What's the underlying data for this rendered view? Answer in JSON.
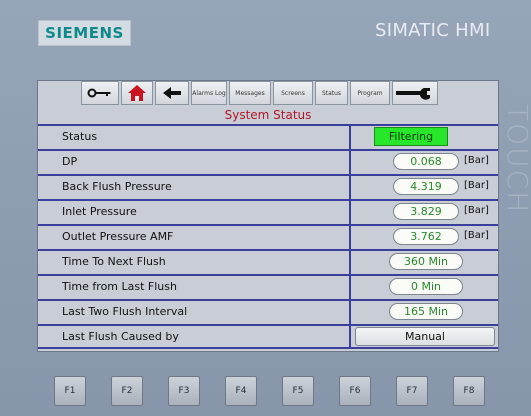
{
  "header": {
    "logo_text": "SIEMENS",
    "brand": "SIMATIC HMI",
    "side_text": "TOUCH"
  },
  "toolbar": {
    "buttons": [
      {
        "icon": "key-icon",
        "label": ""
      },
      {
        "icon": "home-icon",
        "label": ""
      },
      {
        "icon": "back-arrow-icon",
        "label": ""
      },
      {
        "icon": "",
        "label": "Alarms Log"
      },
      {
        "icon": "",
        "label": "Messages"
      },
      {
        "icon": "",
        "label": "Screens"
      },
      {
        "icon": "",
        "label": "Status"
      },
      {
        "icon": "",
        "label": "Program"
      },
      {
        "icon": "wrench-icon",
        "label": ""
      }
    ]
  },
  "screen": {
    "title": "System Status"
  },
  "rows": [
    {
      "label": "Status",
      "value": "Filtering",
      "unit": "",
      "kind": "status"
    },
    {
      "label": "DP",
      "value": "0.068",
      "unit": "[Bar]",
      "kind": "numeric"
    },
    {
      "label": "Back Flush Pressure",
      "value": "4.319",
      "unit": "[Bar]",
      "kind": "numeric"
    },
    {
      "label": "Inlet Pressure",
      "value": "3.829",
      "unit": "[Bar]",
      "kind": "numeric"
    },
    {
      "label": "Outlet Pressure AMF",
      "value": "3.762",
      "unit": "[Bar]",
      "kind": "numeric"
    },
    {
      "label": "Time To Next Flush",
      "value": "360 Min",
      "unit": "",
      "kind": "time"
    },
    {
      "label": "Time from Last Flush",
      "value": "0 Min",
      "unit": "",
      "kind": "time"
    },
    {
      "label": "Last Two Flush Interval",
      "value": "165 Min",
      "unit": "",
      "kind": "time"
    },
    {
      "label": "Last Flush Caused by",
      "value": "Manual",
      "unit": "",
      "kind": "text"
    }
  ],
  "function_keys": [
    "F1",
    "F2",
    "F3",
    "F4",
    "F5",
    "F6",
    "F7",
    "F8"
  ],
  "colors": {
    "title_red": "#b0182a",
    "value_green": "#2a8a2a",
    "status_green": "#28e62a",
    "divider_blue": "#3a3f9e"
  }
}
